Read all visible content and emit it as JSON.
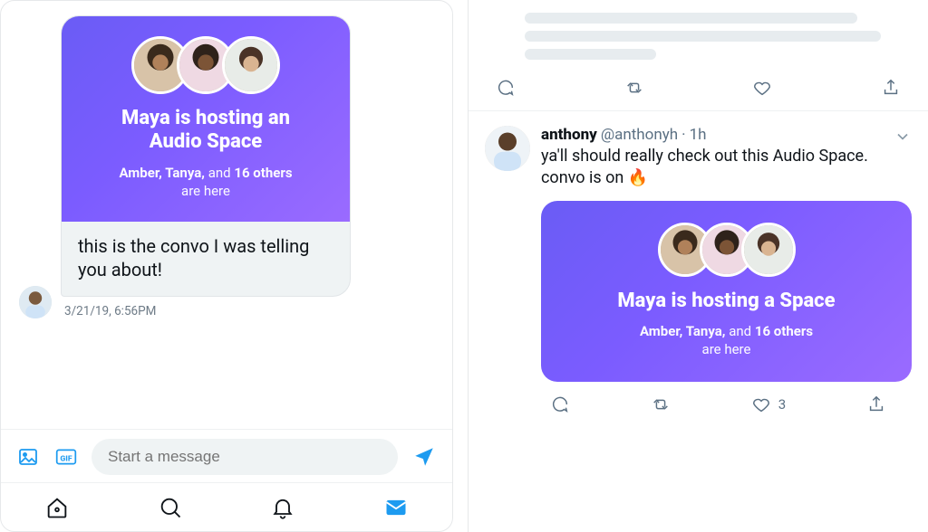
{
  "colors": {
    "accent": "#1d9bf0",
    "space_grad_a": "#6a5cf5",
    "space_grad_b": "#9a6bff"
  },
  "left": {
    "space": {
      "title_l1": "Maya is hosting an",
      "title_l2": "Audio Space",
      "sub_names": "Amber, Tanya,",
      "sub_mid": " and ",
      "sub_count": "16 others",
      "sub_tail": "are here"
    },
    "message_text": "this is the convo I was telling you about!",
    "timestamp": "3/21/19, 6:56PM",
    "composer_placeholder": "Start a message"
  },
  "right": {
    "tweet": {
      "display_name": "anthony",
      "handle": "@anthonyh",
      "sep": " · ",
      "time": "1h",
      "text_pre": "ya'll should really check out this Audio Space. convo is on ",
      "emoji": "🔥"
    },
    "space": {
      "title": "Maya is hosting a Space",
      "sub_names": "Amber, Tanya,",
      "sub_mid": " and ",
      "sub_count": "16 others",
      "sub_tail": "are here"
    },
    "like_count": "3"
  }
}
